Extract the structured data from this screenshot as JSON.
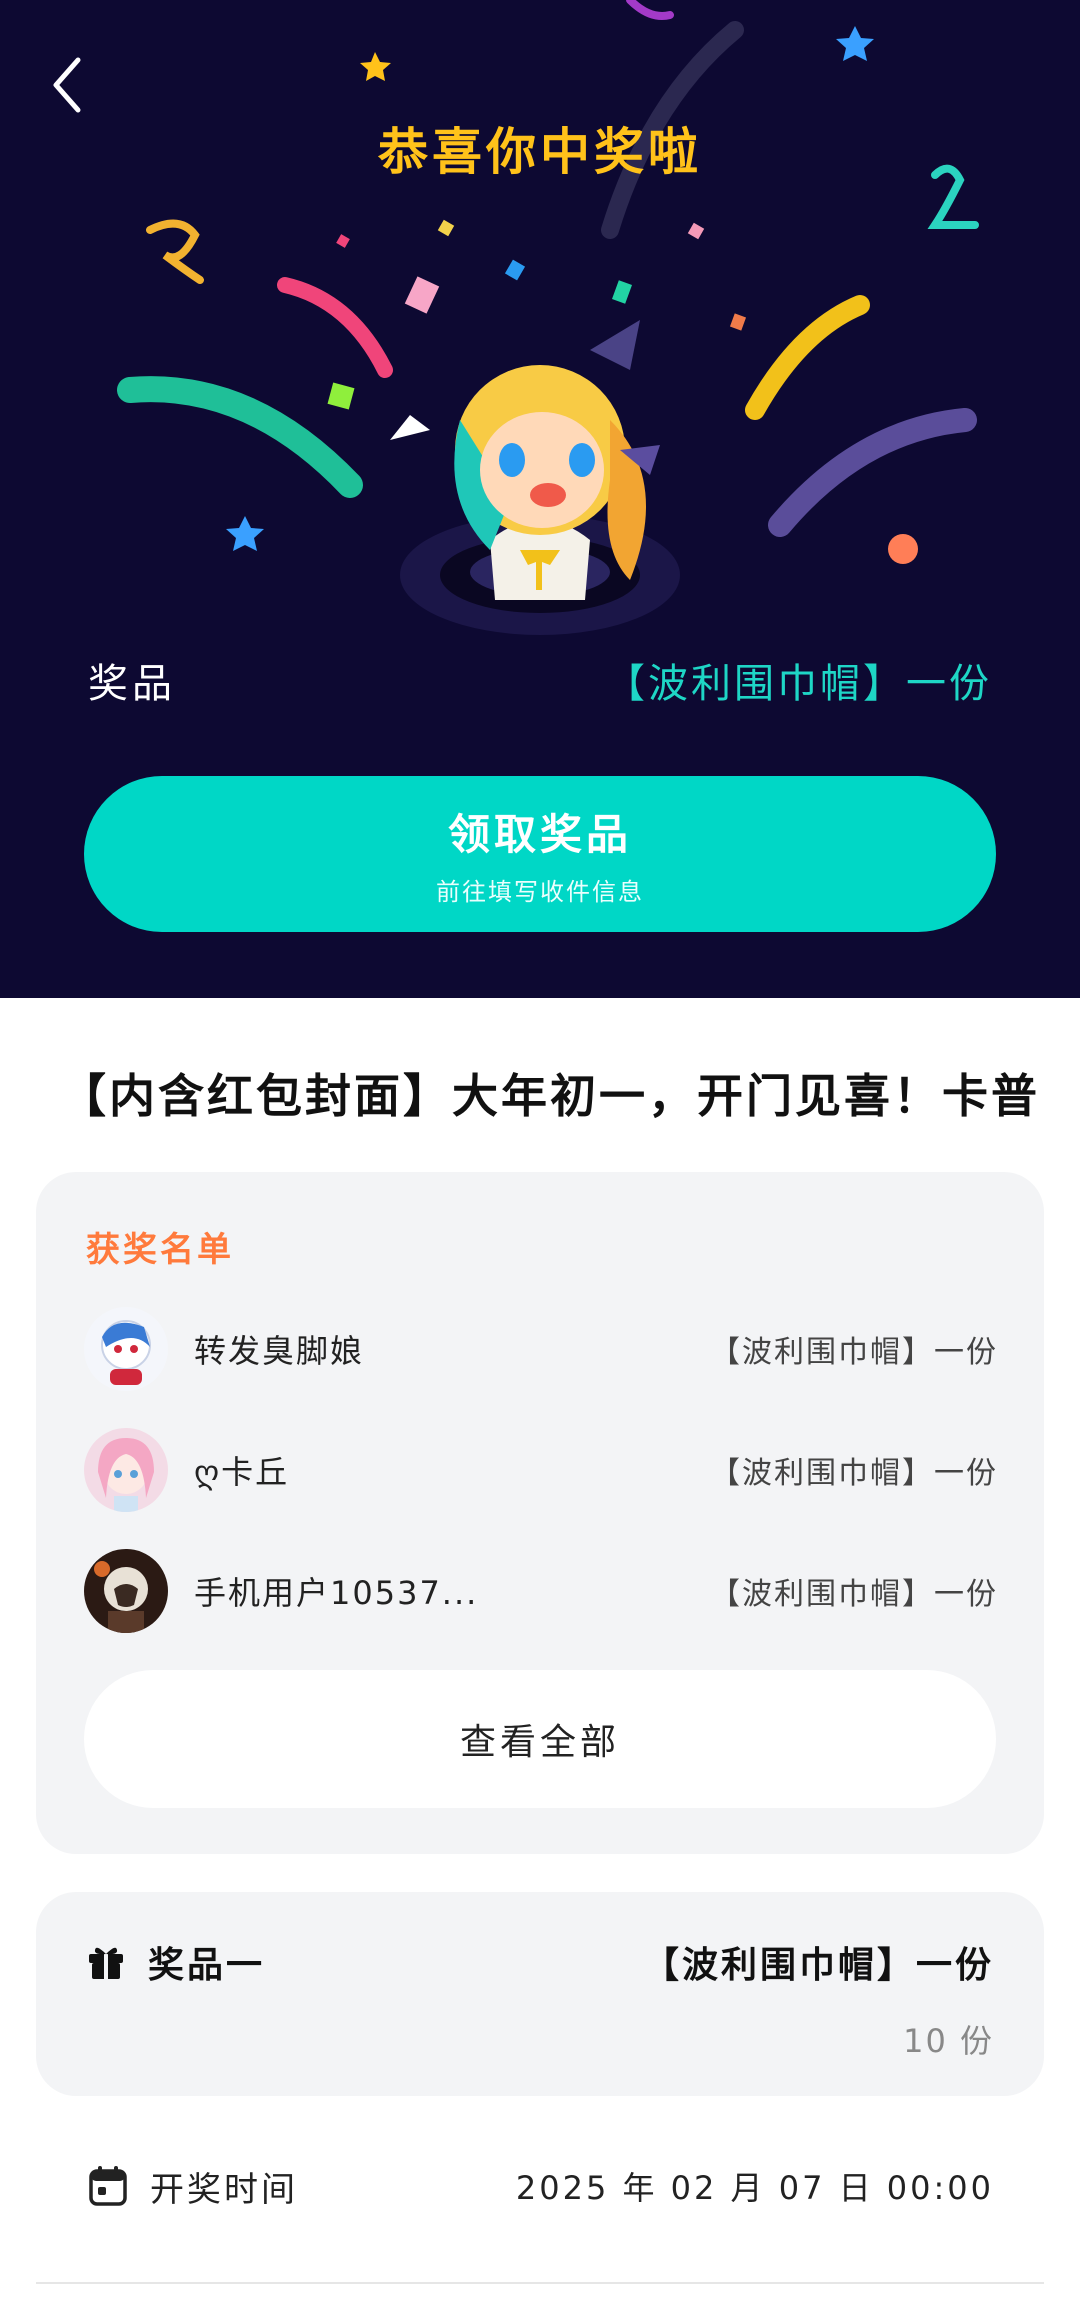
{
  "hero": {
    "title": "恭喜你中奖啦",
    "prize_label": "奖品",
    "prize_value": "【波利围巾帽】一份",
    "claim_button": "领取奖品",
    "claim_sub": "前往填写收件信息"
  },
  "event": {
    "title": "【内含红包封面】大年初一，开门见喜！卡普"
  },
  "winners": {
    "title": "获奖名单",
    "items": [
      {
        "name": "转发臭脚娘",
        "prize": "【波利围巾帽】一份"
      },
      {
        "name": "ღ卡丘",
        "prize": "【波利围巾帽】一份"
      },
      {
        "name": "手机用户10537...",
        "prize": "【波利围巾帽】一份"
      }
    ],
    "view_all": "查看全部"
  },
  "prize_card": {
    "label": "奖品一",
    "value": "【波利围巾帽】一份",
    "count": "10 份"
  },
  "draw": {
    "label": "开奖时间",
    "time": "2025 年 02 月 07 日 00:00"
  },
  "colors": {
    "hero_bg": "#0d0932",
    "accent": "#00d7c6",
    "title_yellow": "#ffc21a",
    "winners_title": "#ff7a3c"
  }
}
